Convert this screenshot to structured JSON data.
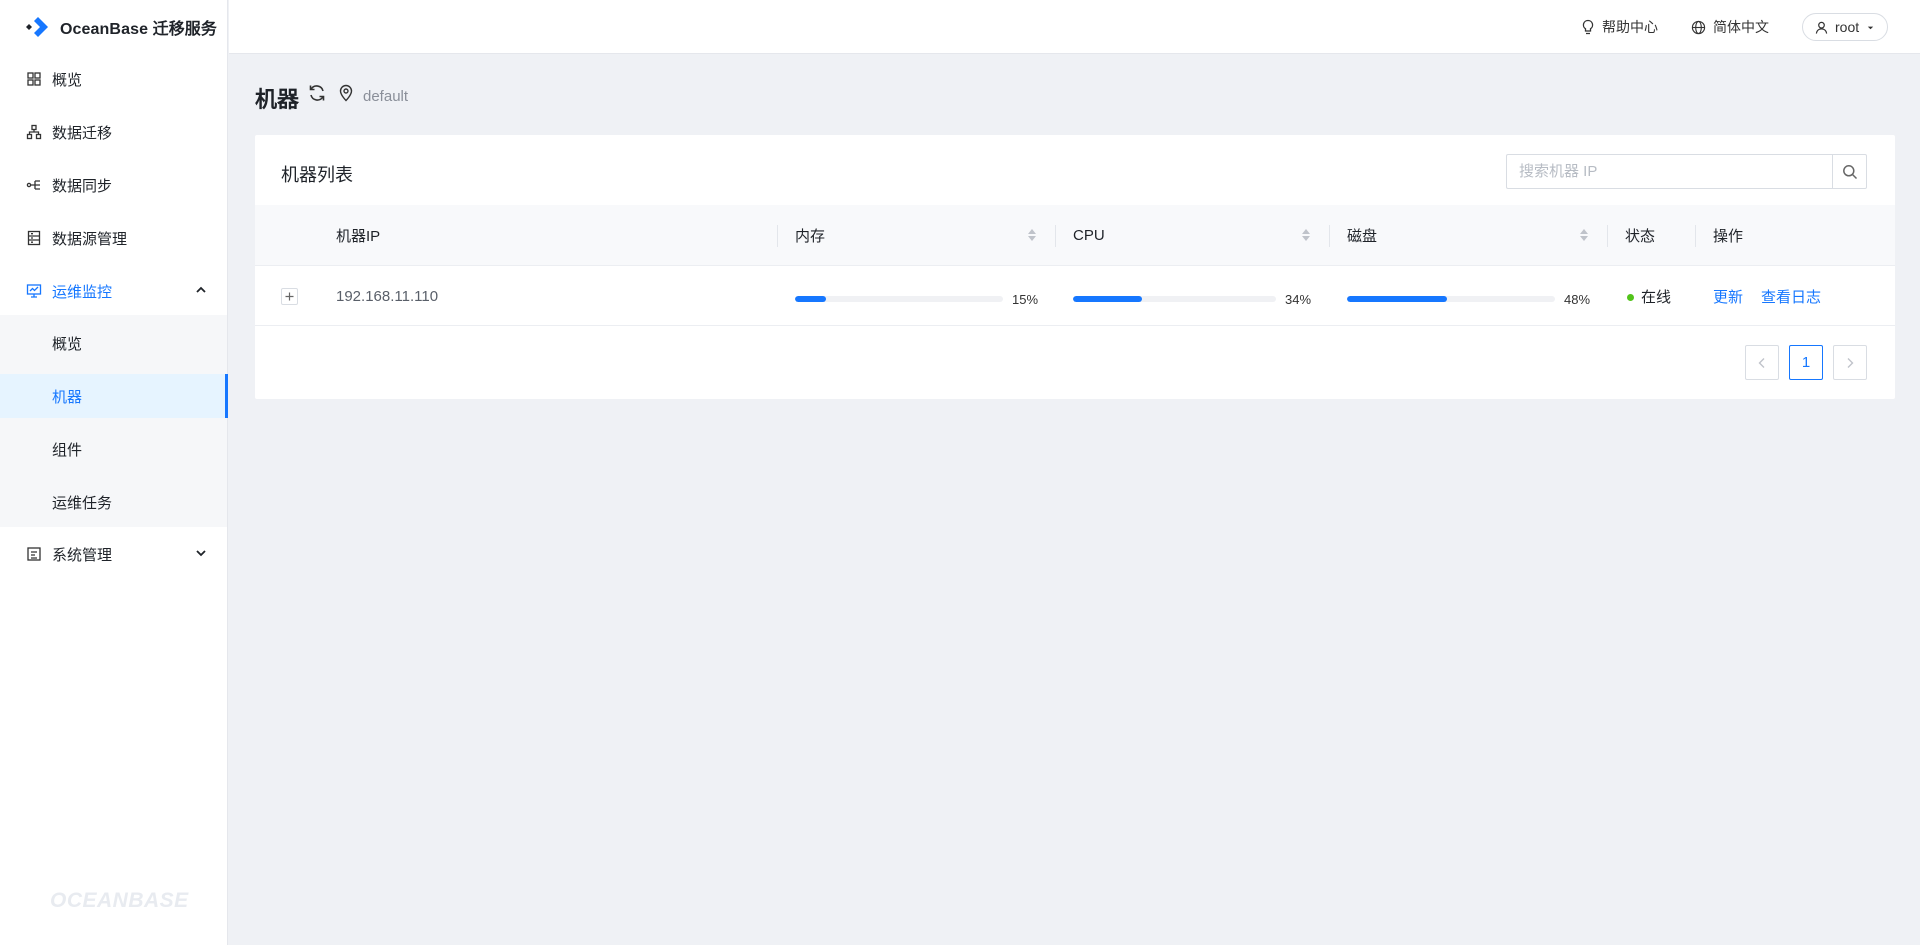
{
  "app": {
    "brand": "OceanBase 迁移服务",
    "watermark": "OCEANBASE"
  },
  "sidebar": {
    "items": [
      {
        "label": "概览",
        "icon": "dashboard-icon"
      },
      {
        "label": "数据迁移",
        "icon": "sitemap-icon"
      },
      {
        "label": "数据同步",
        "icon": "sync-icon"
      },
      {
        "label": "数据源管理",
        "icon": "database-icon"
      },
      {
        "label": "运维监控",
        "icon": "monitor-icon",
        "expanded": true
      },
      {
        "label": "系统管理",
        "icon": "system-icon",
        "expanded": false
      }
    ],
    "submenu": [
      {
        "label": "概览"
      },
      {
        "label": "机器",
        "active": true
      },
      {
        "label": "组件"
      },
      {
        "label": "运维任务"
      }
    ]
  },
  "header": {
    "help": "帮助中心",
    "language": "简体中文",
    "user": "root"
  },
  "page": {
    "title": "机器",
    "location": "default"
  },
  "card": {
    "title": "机器列表",
    "search_placeholder": "搜索机器 IP"
  },
  "table": {
    "columns": {
      "ip": "机器IP",
      "memory": "内存",
      "cpu": "CPU",
      "disk": "磁盘",
      "status": "状态",
      "actions": "操作"
    },
    "rows": [
      {
        "ip": "192.168.11.110",
        "memory": {
          "value": 15,
          "label": "15%"
        },
        "cpu": {
          "value": 34,
          "label": "34%"
        },
        "disk": {
          "value": 48,
          "label": "48%"
        },
        "status": "在线",
        "actions": {
          "update": "更新",
          "logs": "查看日志"
        }
      }
    ]
  },
  "pagination": {
    "current": "1"
  },
  "colors": {
    "accent": "#1677ff",
    "online": "#52c41a",
    "background": "#eff1f5"
  }
}
